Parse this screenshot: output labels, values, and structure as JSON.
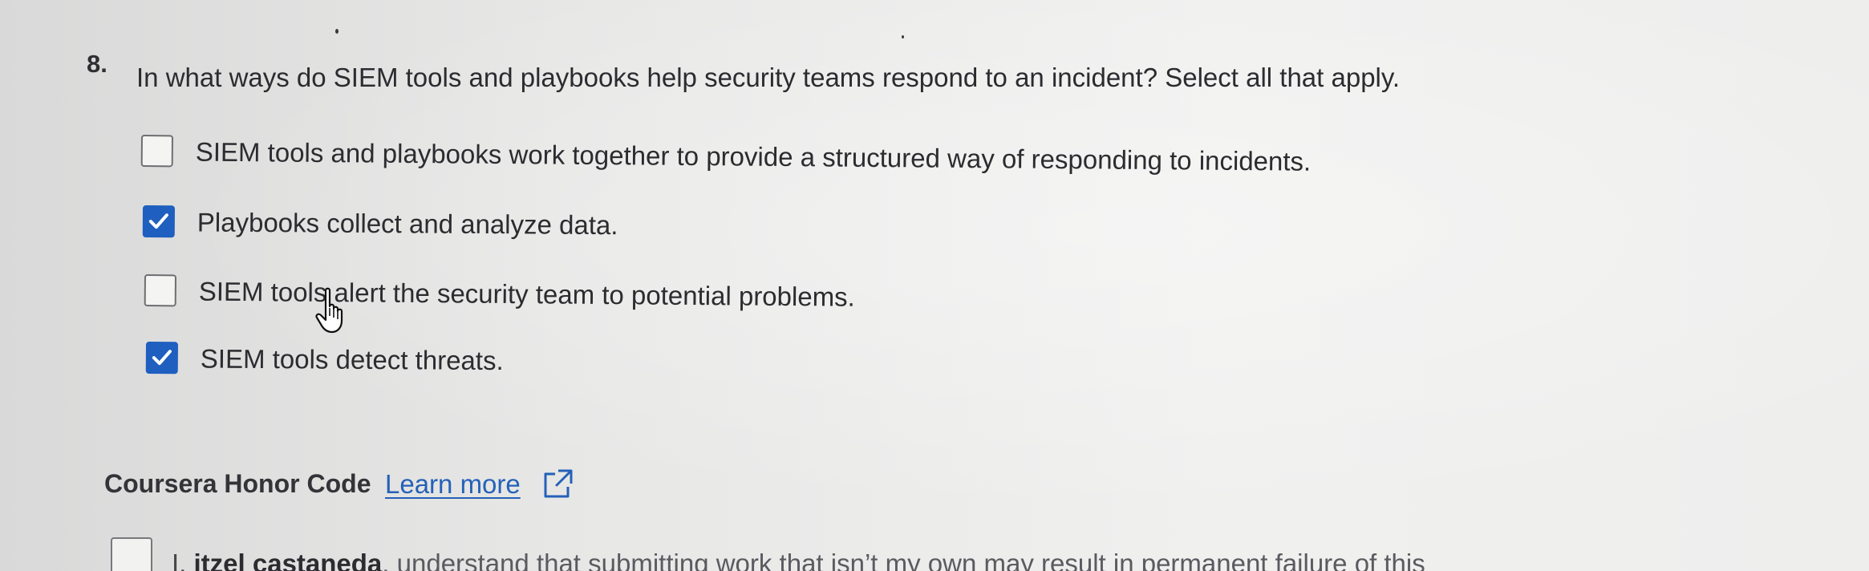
{
  "question": {
    "number": "8.",
    "text": "In what ways do SIEM tools and playbooks help security teams respond to an incident? Select all that apply."
  },
  "options": [
    {
      "label": "SIEM tools and playbooks work together to provide a structured way of responding to incidents.",
      "checked": false
    },
    {
      "label": "Playbooks collect and analyze data.",
      "checked": true
    },
    {
      "label": "SIEM tools alert the security team to potential problems.",
      "checked": false
    },
    {
      "label": "SIEM tools detect threats.",
      "checked": true
    }
  ],
  "honor_code": {
    "title": "Coursera Honor Code",
    "link_label": "Learn more",
    "link_icon": "external-link-icon"
  },
  "pledge": {
    "prefix": "I, ",
    "name": "itzel castaneda",
    "rest": ", understand that submitting work that isn’t my own may result in permanent failure of this"
  },
  "colors": {
    "checkbox_checked": "#1f5fbf",
    "link": "#2561b8",
    "text": "#2a2a2d"
  }
}
